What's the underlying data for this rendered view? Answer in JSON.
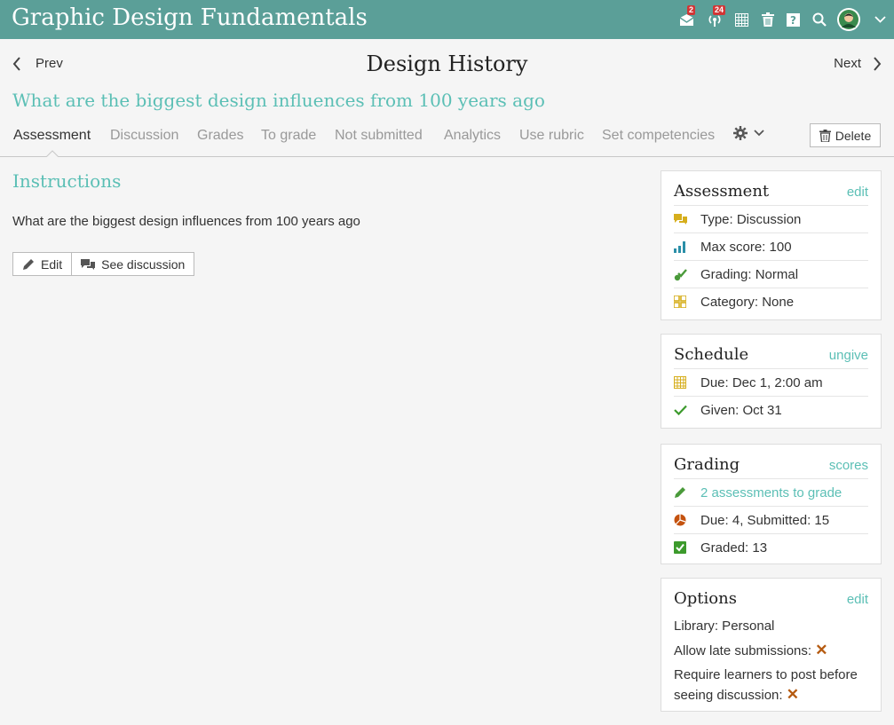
{
  "app": {
    "title": "Graphic Design Fundamentals",
    "badges": {
      "messages": "2",
      "notifications": "24"
    }
  },
  "nav": {
    "prev_label": "Prev",
    "next_label": "Next",
    "page_title": "Design History",
    "assessment_title": "What are the biggest design influences from 100 years ago"
  },
  "tabs": [
    {
      "label": "Assessment"
    },
    {
      "label": "Discussion"
    },
    {
      "label": "Grades"
    },
    {
      "label": "To grade"
    },
    {
      "label": "Not submitted"
    },
    {
      "label": "Analytics"
    },
    {
      "label": "Use rubric"
    },
    {
      "label": "Set competencies"
    }
  ],
  "delete_label": "Delete",
  "instructions": {
    "title": "Instructions",
    "text": "What are the biggest design influences from 100 years ago",
    "edit_label": "Edit",
    "see_discussion_label": "See discussion"
  },
  "assessment_panel": {
    "title": "Assessment",
    "link": "edit",
    "rows": [
      {
        "text": "Type: Discussion",
        "icon": "speech-bubbles-icon"
      },
      {
        "text": "Max score: 100",
        "icon": "bar-chart-icon"
      },
      {
        "text": "Grading: Normal",
        "icon": "grading-check-icon"
      },
      {
        "text": "Category: None",
        "icon": "category-grid-icon"
      }
    ]
  },
  "schedule_panel": {
    "title": "Schedule",
    "link": "ungive",
    "rows": [
      {
        "text": "Due: Dec 1, 2:00 am",
        "icon": "calendar-icon"
      },
      {
        "text": "Given: Oct 31",
        "icon": "checkmark-icon"
      }
    ]
  },
  "grading_panel": {
    "title": "Grading",
    "link": "scores",
    "rows": [
      {
        "text": "2 assessments to grade",
        "icon": "pencil-icon"
      },
      {
        "text": "Due: 4, Submitted: 15",
        "icon": "pie-chart-icon"
      },
      {
        "text": "Graded: 13",
        "icon": "graded-check-icon"
      }
    ]
  },
  "options_panel": {
    "title": "Options",
    "link": "edit",
    "library": "Library: Personal",
    "late": "Allow late submissions:",
    "require_line1": "Require learners to post before",
    "require_line2": "seeing discussion:"
  },
  "colors": {
    "topbar": "#5b9f98",
    "accent": "#5bbfb5",
    "badge": "#d23535",
    "x_mark": "#b55a10"
  }
}
